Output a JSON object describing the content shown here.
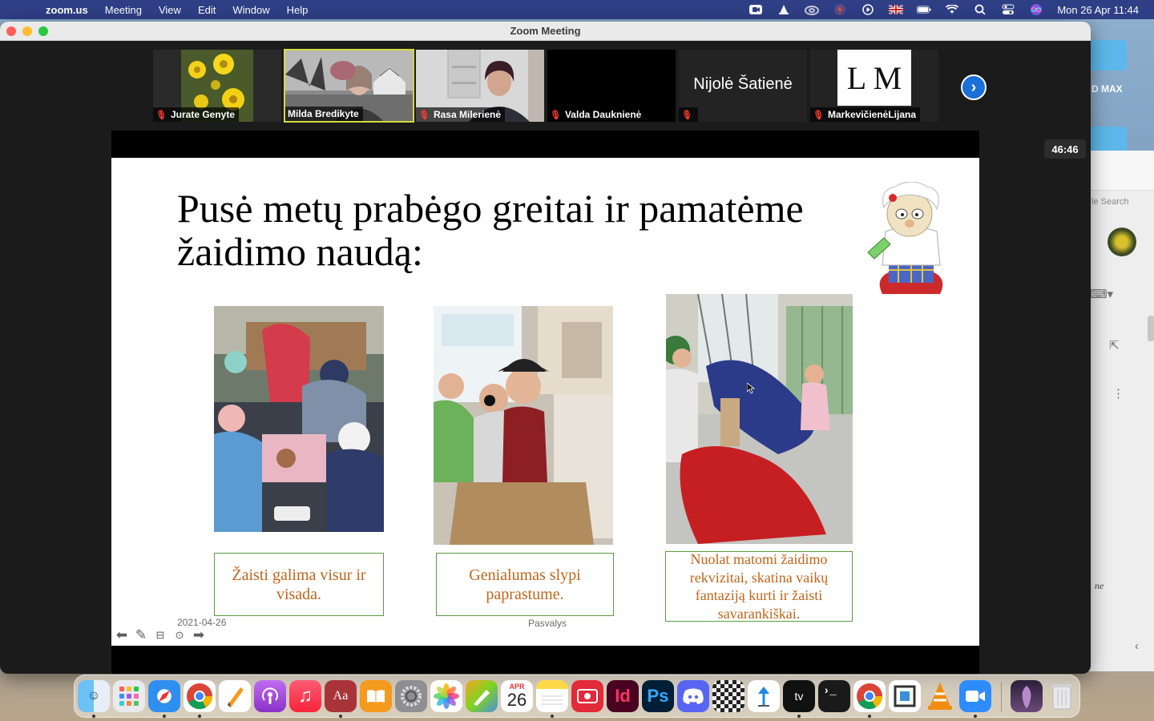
{
  "menubar": {
    "app_name": "zoom.us",
    "items": [
      "Meeting",
      "View",
      "Edit",
      "Window",
      "Help"
    ],
    "clock": "Mon 26 Apr  11:44"
  },
  "desktop": {
    "folder_label": "D MAX",
    "bg_window_search": "le Search",
    "bg_window_note": "ne"
  },
  "window": {
    "title": "Zoom Meeting"
  },
  "participants": [
    {
      "name": "Jurate Genyte",
      "muted": true
    },
    {
      "name": "Milda Bredikyte",
      "muted": false,
      "active_speaker": true
    },
    {
      "name": "Rasa Milerienė",
      "muted": true
    },
    {
      "name": "Valda Dauknienė",
      "muted": true
    },
    {
      "name": "Nijolė Šatienė",
      "muted": true,
      "display": "Nijolė Šatienė"
    },
    {
      "name": "MarkevičienėLijana",
      "muted": true,
      "avatar_text": "L M"
    }
  ],
  "timer": "46:46",
  "slide": {
    "title_line1": "Pusė metų prabėgo greitai ir pamatėme",
    "title_line2": "žaidimo naudą:",
    "captions": [
      "Žaisti galima visur ir visada.",
      "Genialumas slypi paprastume.",
      "Nuolat matomi žaidimo rekvizitai, skatina vaikų fantaziją kurti ir žaisti savarankiškai."
    ],
    "footer_date": "2021-04-26",
    "footer_place": "Pasvalys"
  },
  "colors": {
    "menubar": "#2f3f86",
    "caption_text": "#c0651a",
    "caption_border": "#5b9a43",
    "active_speaker_border": "#d6d93f",
    "next_button": "#1b6fd8"
  },
  "dock": {
    "apps": [
      "Finder",
      "Launchpad",
      "Safari",
      "Google Chrome",
      "Pages",
      "Podcasts",
      "Music",
      "Dictionary",
      "Books",
      "System Preferences",
      "Photos",
      "Pixelmator",
      "Calendar",
      "Notes",
      "Photo Booth",
      "InDesign",
      "Photoshop",
      "Discord",
      "Chess",
      "Keynote",
      "TV",
      "Terminal",
      "Google Chrome",
      "Preview",
      "VLC",
      "Zoom",
      "Downloads",
      "Trash"
    ],
    "calendar_month": "APR",
    "calendar_day": "26",
    "indesign_label": "Id",
    "photoshop_label": "Ps",
    "dictionary_label": "Aa",
    "tv_label": "tv"
  }
}
